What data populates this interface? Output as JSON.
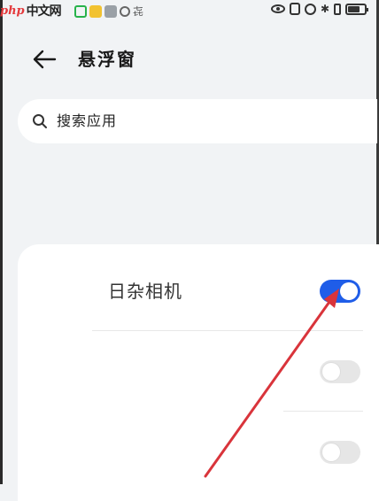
{
  "watermark": {
    "brand": "php",
    "site": "中文网"
  },
  "status_bar": {
    "left_icons": [
      "sim-icon",
      "wechat-icon",
      "notification-icon",
      "app-icon",
      "message-icon"
    ],
    "left_char": "㐂",
    "right_icons": [
      "eye-comfort-icon",
      "nfc-icon",
      "alarm-icon",
      "bluetooth-icon",
      "vibrate-icon",
      "battery-icon"
    ],
    "bluetooth_glyph": "✱"
  },
  "header": {
    "title": "悬浮窗",
    "back_icon": "arrow-left-icon"
  },
  "search": {
    "placeholder": "搜索应用",
    "icon": "search-icon"
  },
  "apps": [
    {
      "label": "日杂相机",
      "enabled": true
    },
    {
      "label": "",
      "enabled": false
    },
    {
      "label": "",
      "enabled": false
    }
  ],
  "colors": {
    "background": "#f1f3f5",
    "card": "#ffffff",
    "accent": "#1f5de8",
    "toggle_off": "#e6e6e6",
    "annotation": "#d9343b"
  }
}
